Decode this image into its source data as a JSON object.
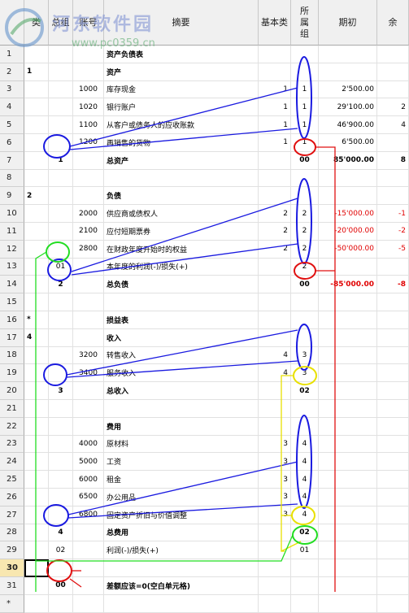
{
  "headers": {
    "class": "类",
    "group": "总组",
    "account": "账号",
    "description": "摘要",
    "basic_class": "基本类",
    "belongs_group": "所属组",
    "opening": "期初",
    "extra": "余"
  },
  "watermark": {
    "site_name": "河东软件园",
    "url": "www.pc0359.cn"
  },
  "rows": [
    {
      "n": "1",
      "class": "",
      "group": "",
      "account": "",
      "desc": "资产负债表",
      "basic": "",
      "belongs": "",
      "opening": "",
      "extra": "",
      "bold": true
    },
    {
      "n": "2",
      "class": "1",
      "group": "",
      "account": "",
      "desc": "资产",
      "basic": "",
      "belongs": "",
      "opening": "",
      "extra": "",
      "bold": true
    },
    {
      "n": "3",
      "class": "",
      "group": "",
      "account": "1000",
      "desc": "库存现金",
      "basic": "1",
      "belongs": "1",
      "opening": "2'500.00",
      "extra": ""
    },
    {
      "n": "4",
      "class": "",
      "group": "",
      "account": "1020",
      "desc": "银行账户",
      "basic": "1",
      "belongs": "1",
      "opening": "29'100.00",
      "extra": "2"
    },
    {
      "n": "5",
      "class": "",
      "group": "",
      "account": "1100",
      "desc": "从客户或债务人的应收账款",
      "basic": "1",
      "belongs": "1",
      "opening": "46'900.00",
      "extra": "4"
    },
    {
      "n": "6",
      "class": "",
      "group": "",
      "account": "1200",
      "desc": "再销售的货物",
      "basic": "1",
      "belongs": "1",
      "opening": "6'500.00",
      "extra": ""
    },
    {
      "n": "7",
      "class": "",
      "group": "1",
      "account": "",
      "desc": "总资产",
      "basic": "",
      "belongs": "00",
      "opening": "85'000.00",
      "extra": "8",
      "bold": true
    },
    {
      "n": "8",
      "class": "",
      "group": "",
      "account": "",
      "desc": "",
      "basic": "",
      "belongs": "",
      "opening": "",
      "extra": ""
    },
    {
      "n": "9",
      "class": "2",
      "group": "",
      "account": "",
      "desc": "负债",
      "basic": "",
      "belongs": "",
      "opening": "",
      "extra": "",
      "bold": true
    },
    {
      "n": "10",
      "class": "",
      "group": "",
      "account": "2000",
      "desc": "供应商或债权人",
      "basic": "2",
      "belongs": "2",
      "opening": "-15'000.00",
      "extra": "-1",
      "red": true
    },
    {
      "n": "11",
      "class": "",
      "group": "",
      "account": "2100",
      "desc": "应付短期票券",
      "basic": "2",
      "belongs": "2",
      "opening": "-20'000.00",
      "extra": "-2",
      "red": true
    },
    {
      "n": "12",
      "class": "",
      "group": "",
      "account": "2800",
      "desc": "在财政年度开始时的权益",
      "basic": "2",
      "belongs": "2",
      "opening": "-50'000.00",
      "extra": "-5",
      "red": true
    },
    {
      "n": "13",
      "class": "",
      "group": "01",
      "account": "",
      "desc": "本年度的利润(-)/损失(+)",
      "basic": "",
      "belongs": "2",
      "opening": "",
      "extra": ""
    },
    {
      "n": "14",
      "class": "",
      "group": "2",
      "account": "",
      "desc": "总负债",
      "basic": "",
      "belongs": "00",
      "opening": "-85'000.00",
      "extra": "-8",
      "bold": true,
      "red": true
    },
    {
      "n": "15",
      "class": "",
      "group": "",
      "account": "",
      "desc": "",
      "basic": "",
      "belongs": "",
      "opening": "",
      "extra": ""
    },
    {
      "n": "16",
      "class": "*",
      "group": "",
      "account": "",
      "desc": "损益表",
      "basic": "",
      "belongs": "",
      "opening": "",
      "extra": "",
      "bold": true
    },
    {
      "n": "17",
      "class": "4",
      "group": "",
      "account": "",
      "desc": "收入",
      "basic": "",
      "belongs": "",
      "opening": "",
      "extra": "",
      "bold": true
    },
    {
      "n": "18",
      "class": "",
      "group": "",
      "account": "3200",
      "desc": "转售收入",
      "basic": "4",
      "belongs": "3",
      "opening": "",
      "extra": ""
    },
    {
      "n": "19",
      "class": "",
      "group": "",
      "account": "3400",
      "desc": "服务收入",
      "basic": "4",
      "belongs": "3",
      "opening": "",
      "extra": ""
    },
    {
      "n": "20",
      "class": "",
      "group": "3",
      "account": "",
      "desc": "总收入",
      "basic": "",
      "belongs": "02",
      "opening": "",
      "extra": "",
      "bold": true
    },
    {
      "n": "21",
      "class": "",
      "group": "",
      "account": "",
      "desc": "",
      "basic": "",
      "belongs": "",
      "opening": "",
      "extra": ""
    },
    {
      "n": "22",
      "class": "",
      "group": "",
      "account": "",
      "desc": "费用",
      "basic": "",
      "belongs": "",
      "opening": "",
      "extra": "",
      "bold": true
    },
    {
      "n": "23",
      "class": "",
      "group": "",
      "account": "4000",
      "desc": "原材料",
      "basic": "3",
      "belongs": "4",
      "opening": "",
      "extra": ""
    },
    {
      "n": "24",
      "class": "",
      "group": "",
      "account": "5000",
      "desc": "工资",
      "basic": "3",
      "belongs": "4",
      "opening": "",
      "extra": ""
    },
    {
      "n": "25",
      "class": "",
      "group": "",
      "account": "6000",
      "desc": "租金",
      "basic": "3",
      "belongs": "4",
      "opening": "",
      "extra": ""
    },
    {
      "n": "26",
      "class": "",
      "group": "",
      "account": "6500",
      "desc": "办公用品",
      "basic": "3",
      "belongs": "4",
      "opening": "",
      "extra": ""
    },
    {
      "n": "27",
      "class": "",
      "group": "",
      "account": "6800",
      "desc": "固定资产折旧与价值调整",
      "basic": "3",
      "belongs": "4",
      "opening": "",
      "extra": ""
    },
    {
      "n": "28",
      "class": "",
      "group": "4",
      "account": "",
      "desc": "总费用",
      "basic": "",
      "belongs": "02",
      "opening": "",
      "extra": "",
      "bold": true
    },
    {
      "n": "29",
      "class": "",
      "group": "02",
      "account": "",
      "desc": "利润(-)/损失(+)",
      "basic": "",
      "belongs": "01",
      "opening": "",
      "extra": ""
    },
    {
      "n": "30",
      "class": "",
      "group": "",
      "account": "",
      "desc": "",
      "basic": "",
      "belongs": "",
      "opening": "",
      "extra": "",
      "selected": true
    },
    {
      "n": "31",
      "class": "",
      "group": "00",
      "account": "",
      "desc": "差额应该=0(空白单元格)",
      "basic": "",
      "belongs": "",
      "opening": "",
      "extra": "",
      "bold": true
    },
    {
      "n": "*",
      "class": "",
      "group": "",
      "account": "",
      "desc": "",
      "basic": "",
      "belongs": "",
      "opening": "",
      "extra": ""
    }
  ],
  "colors": {
    "header_bg": "#f0f0f0",
    "selected_row_bg": "#f8e7b0",
    "negative": "#e00000",
    "annot_blue": "#1a1ae0",
    "annot_red": "#e01010",
    "annot_yellow": "#e8e000",
    "annot_green": "#22dd22"
  }
}
